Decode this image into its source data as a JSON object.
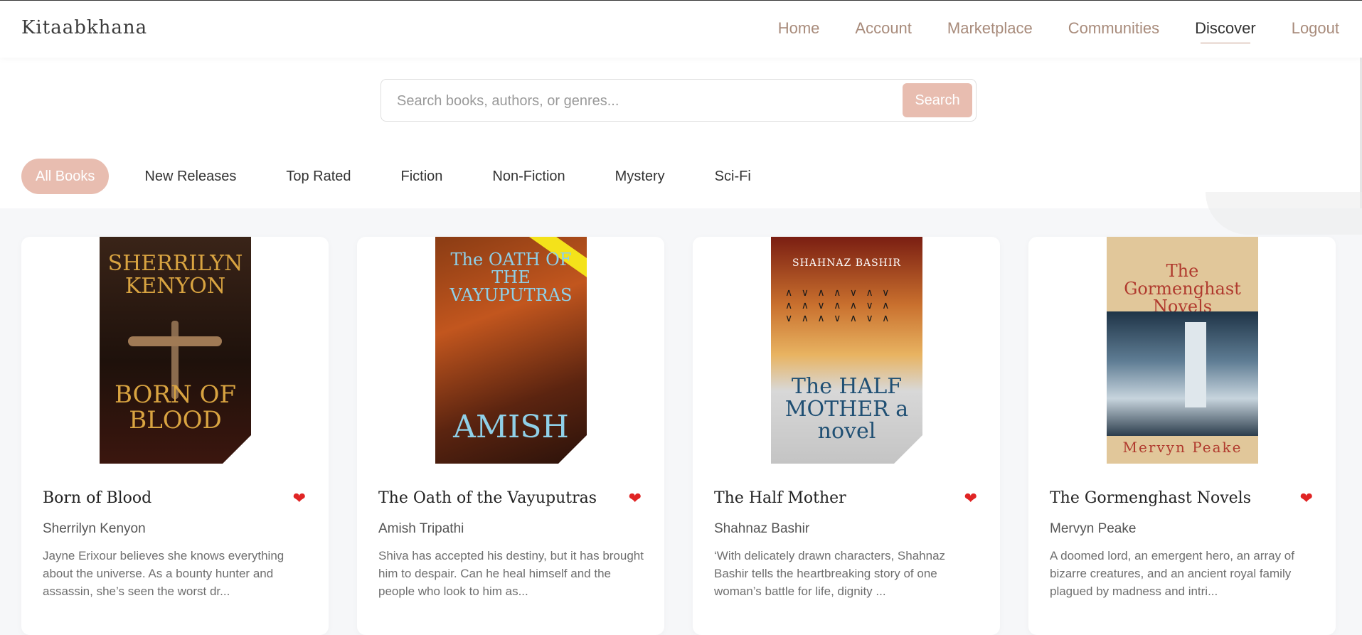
{
  "header": {
    "brand": "Kitaabkhana",
    "nav": [
      {
        "label": "Home"
      },
      {
        "label": "Account"
      },
      {
        "label": "Marketplace"
      },
      {
        "label": "Communities"
      },
      {
        "label": "Discover",
        "active": true
      },
      {
        "label": "Logout"
      }
    ]
  },
  "search": {
    "placeholder": "Search books, authors, or genres...",
    "button_label": "Search"
  },
  "filters": [
    {
      "label": "All Books",
      "active": true
    },
    {
      "label": "New Releases"
    },
    {
      "label": "Top Rated"
    },
    {
      "label": "Fiction"
    },
    {
      "label": "Non-Fiction"
    },
    {
      "label": "Mystery"
    },
    {
      "label": "Sci-Fi"
    }
  ],
  "books": [
    {
      "title": "Born of Blood",
      "author": "Sherrilyn Kenyon",
      "description": "Jayne Erixour believes she knows everything about the universe. As a bounty hunter and assassin, she’s seen the worst dr...",
      "cover": {
        "top": "SHERRILYN KENYON",
        "bottom": "BORN OF BLOOD",
        "bg": "#2a1a12",
        "fg": "#d9a441"
      }
    },
    {
      "title": "The Oath of the Vayuputras",
      "author": "Amish Tripathi",
      "description": "Shiva has accepted his destiny, but it has brought him to despair. Can he heal himself and the people who look to him as...",
      "cover": {
        "top": "The OATH OF THE VAYUPUTRAS",
        "bottom": "AMISH",
        "bg": "#6b2f16",
        "fg": "#8fd0e8"
      }
    },
    {
      "title": "The Half Mother",
      "author": "Shahnaz Bashir",
      "description": "‘With delicately drawn characters, Shahnaz Bashir tells the heartbreaking story of one woman’s battle for life, dignity ...",
      "cover": {
        "top": "SHAHNAZ BASHIR",
        "bottom": "The HALF MOTHER a novel",
        "bg": "#c9702e",
        "fg": "#1f4f73"
      }
    },
    {
      "title": "The Gormenghast Novels",
      "author": "Mervyn Peake",
      "description": "A doomed lord, an emergent hero, an array of bizarre creatures, and an ancient royal family plagued by madness and intri...",
      "cover": {
        "top": "The Gormenghast Novels",
        "bottom": "Mervyn Peake",
        "bg": "#e1c79a",
        "fg": "#b03a2e"
      }
    }
  ],
  "heart_icon": "heart-icon",
  "colors": {
    "accent": "#e8bdb0",
    "nav_text": "#a88b7b",
    "heart": "#e02424"
  }
}
